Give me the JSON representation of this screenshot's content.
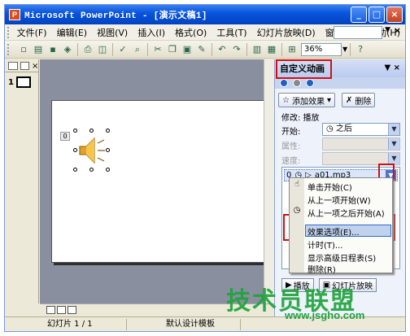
{
  "window": {
    "title": "Microsoft PowerPoint - [演示文稿1]",
    "min_label": "_",
    "max_label": "□",
    "close_label": "×"
  },
  "menubar": {
    "items": [
      "文件(F)",
      "编辑(E)",
      "视图(V)",
      "插入(I)",
      "格式(O)",
      "工具(T)",
      "幻灯片放映(D)",
      "窗口(W)",
      "帮助(H)"
    ]
  },
  "toolbar": {
    "zoom": "36%"
  },
  "thumbnails": {
    "slide_number": "1"
  },
  "slide": {
    "anim_tag": "0"
  },
  "taskpane": {
    "title": "自定义动画",
    "add_effect": "添加效果",
    "remove": "删除",
    "modify_label": "修改: 播放",
    "start_label": "开始:",
    "start_value": "之后",
    "property_label": "属性:",
    "speed_label": "速度:",
    "list_item": {
      "index": "0",
      "name": "a01.mp3"
    },
    "play_button": "播放",
    "slideshow_button": "幻灯片放映"
  },
  "context_menu": {
    "items": [
      "单击开始(C)",
      "从上一项开始(W)",
      "从上一项之后开始(A)",
      "效果选项(E)...",
      "计时(T)...",
      "显示高级日程表(S)",
      "删除(R)"
    ]
  },
  "statusbar": {
    "slide_info": "幻灯片 1 / 1",
    "template": "默认设计模板"
  },
  "watermark": {
    "text": "技术员联盟",
    "url": "www.jsgho.com"
  },
  "colors": {
    "highlight_box": "#d40f0f",
    "title_bar": "#0a55dc",
    "watermark": "#1fa33c"
  }
}
